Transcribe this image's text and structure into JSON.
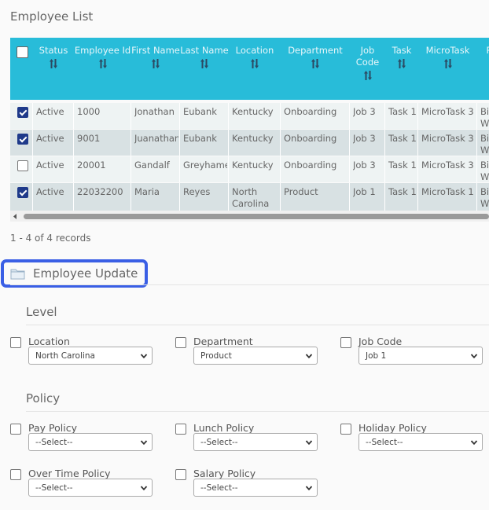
{
  "page": {
    "title": "Employee List"
  },
  "table": {
    "columns": [
      {
        "key": "status",
        "label": "Status"
      },
      {
        "key": "employee_id",
        "label": "Employee Id"
      },
      {
        "key": "first_name",
        "label": "First Name"
      },
      {
        "key": "last_name",
        "label": "Last Name"
      },
      {
        "key": "location",
        "label": "Location"
      },
      {
        "key": "department",
        "label": "Department"
      },
      {
        "key": "job_code",
        "label": "Job Code"
      },
      {
        "key": "task",
        "label": "Task"
      },
      {
        "key": "microtask",
        "label": "MicroTask"
      },
      {
        "key": "policy",
        "label": "P"
      }
    ],
    "rows": [
      {
        "checked": true,
        "status": "Active",
        "employee_id": "1000",
        "first_name": "Jonathan",
        "last_name": "Eubank",
        "location": "Kentucky",
        "department": "Onboarding",
        "job_code": "Job 3",
        "task": "Task 1",
        "microtask": "MicroTask 3",
        "policy": "Bi We"
      },
      {
        "checked": true,
        "status": "Active",
        "employee_id": "9001",
        "first_name": "Juanathan",
        "last_name": "Eubank",
        "location": "Kentucky",
        "department": "Onboarding",
        "job_code": "Job 3",
        "task": "Task 1",
        "microtask": "MicroTask 3",
        "policy": "Bi We"
      },
      {
        "checked": false,
        "status": "Active",
        "employee_id": "20001",
        "first_name": "Gandalf",
        "last_name": "Greyhame",
        "location": "Kentucky",
        "department": "Onboarding",
        "job_code": "Job 3",
        "task": "Task 1",
        "microtask": "MicroTask 3",
        "policy": "Bi We"
      },
      {
        "checked": true,
        "status": "Active",
        "employee_id": "22032200",
        "first_name": "Maria",
        "last_name": "Reyes",
        "location": "North Carolina",
        "department": "Product",
        "job_code": "Job 1",
        "task": "Task 1",
        "microtask": "MicroTask 1",
        "policy": "Bi We"
      }
    ],
    "records_text": "1 - 4 of 4 records"
  },
  "update": {
    "title": "Employee Update",
    "level": {
      "heading": "Level",
      "fields": [
        {
          "label": "Location",
          "value": "North Carolina"
        },
        {
          "label": "Department",
          "value": "Product"
        },
        {
          "label": "Job Code",
          "value": "Job 1"
        }
      ]
    },
    "policy": {
      "heading": "Policy",
      "fields": [
        {
          "label": "Pay Policy",
          "value": "--Select--"
        },
        {
          "label": "Lunch Policy",
          "value": "--Select--"
        },
        {
          "label": "Holiday Policy",
          "value": "--Select--"
        },
        {
          "label": "Over Time Policy",
          "value": "--Select--"
        },
        {
          "label": "Salary Policy",
          "value": "--Select--"
        }
      ]
    }
  },
  "colors": {
    "header_bg": "#28bcd9",
    "highlight": "#3a5fe5",
    "checked": "#1f3a8a"
  },
  "icons": {
    "sort": "sort-arrows-icon",
    "folder": "folder-icon",
    "dropdown": "chevron-down-icon"
  }
}
